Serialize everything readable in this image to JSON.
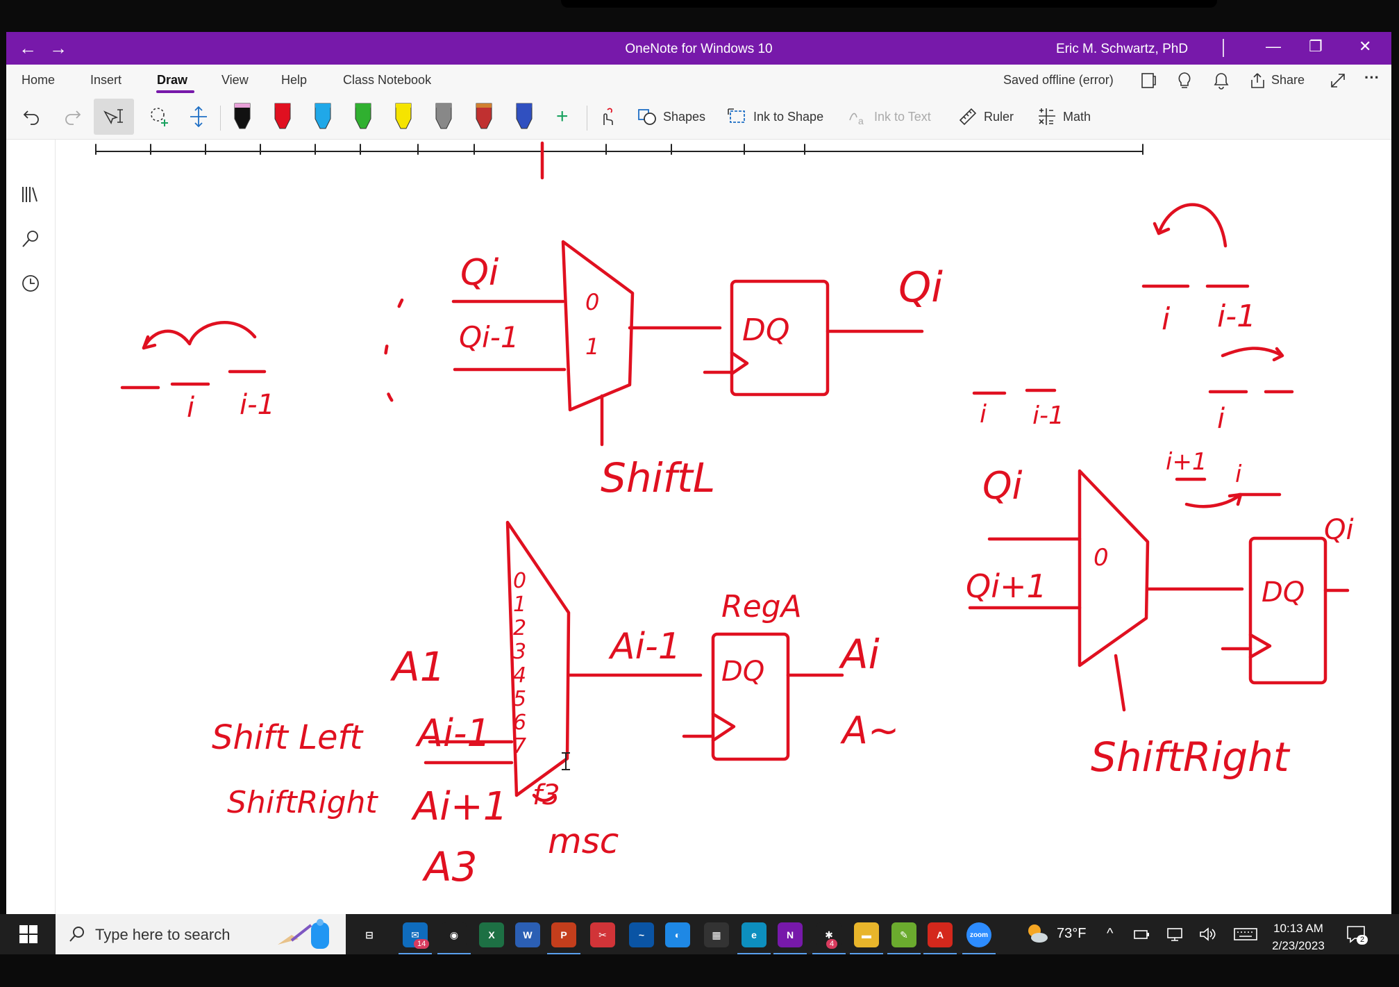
{
  "window": {
    "app_title": "OneNote for Windows 10",
    "user_name": "Eric M. Schwartz, PhD",
    "back_glyph": "←",
    "forward_glyph": "→",
    "minimize_glyph": "—",
    "restore_glyph": "❐",
    "close_glyph": "✕"
  },
  "menu": {
    "tabs": [
      {
        "label": "Home"
      },
      {
        "label": "Insert"
      },
      {
        "label": "Draw",
        "active": true
      },
      {
        "label": "View"
      },
      {
        "label": "Help"
      },
      {
        "label": "Class Notebook"
      }
    ],
    "status": "Saved offline (error)",
    "share_label": "Share",
    "more_glyph": "···"
  },
  "toolbar": {
    "shapes_label": "Shapes",
    "ink_to_shape_label": "Ink to Shape",
    "ink_to_text_label": "Ink to Text",
    "ruler_label": "Ruler",
    "math_label": "Math",
    "add_pen_glyph": "+",
    "pens": [
      {
        "name": "pen-black-pink",
        "color": "#111111",
        "cap": "#e8a0d8"
      },
      {
        "name": "pen-red",
        "color": "#e01020",
        "cap": "#e01020"
      },
      {
        "name": "pen-cyan",
        "color": "#20a8e8",
        "cap": "#20a8e8"
      },
      {
        "name": "pen-green",
        "color": "#30b030",
        "cap": "#30b030"
      },
      {
        "name": "highlighter-yellow",
        "color": "#f5e400",
        "cap": "#f5e400"
      },
      {
        "name": "pencil-gray",
        "color": "#888888",
        "cap": "#888888"
      },
      {
        "name": "pen-galaxy",
        "color": "#c03030",
        "cap": "#d08030"
      },
      {
        "name": "pen-galaxy-blue",
        "color": "#3050c0",
        "cap": "#3050c0"
      }
    ]
  },
  "colors": {
    "accent": "#7719aa",
    "ink": "#e01020"
  },
  "taskbar": {
    "search_placeholder": "Type here to search",
    "weather": "73°F",
    "time": "10:13 AM",
    "date": "2/23/2023",
    "mail_badge": "14",
    "slack_badge": "4",
    "notif_badge": "2",
    "apps": [
      {
        "name": "task-view-icon",
        "label": "⊟",
        "bg": "transparent"
      },
      {
        "name": "mail-app-icon",
        "label": "✉",
        "bg": "#0f6cbd"
      },
      {
        "name": "chrome-app-icon",
        "label": "◉",
        "bg": "#1f1f1f"
      },
      {
        "name": "excel-app-icon",
        "label": "X",
        "bg": "#1d7044"
      },
      {
        "name": "word-app-icon",
        "label": "W",
        "bg": "#2b5fb4"
      },
      {
        "name": "powerpoint-app-icon",
        "label": "P",
        "bg": "#c43e1c"
      },
      {
        "name": "snip-app-icon",
        "label": "✂",
        "bg": "#d13438"
      },
      {
        "name": "whiteboard-app-icon",
        "label": "~",
        "bg": "#0a54a4"
      },
      {
        "name": "app-blue-icon",
        "label": "◐",
        "bg": "#1e88e5"
      },
      {
        "name": "app-chip-icon",
        "label": "▦",
        "bg": "#333333"
      },
      {
        "name": "edge-app-icon",
        "label": "e",
        "bg": "#0d8fbf"
      },
      {
        "name": "onenote-app-icon",
        "label": "N",
        "bg": "#7719aa"
      },
      {
        "name": "slack-app-icon",
        "label": "✱",
        "bg": "#1f1f1f"
      },
      {
        "name": "explorer-app-icon",
        "label": "▬",
        "bg": "#e8b52b"
      },
      {
        "name": "app-green-icon",
        "label": "✎",
        "bg": "#6bab2e"
      },
      {
        "name": "acrobat-app-icon",
        "label": "A",
        "bg": "#d4281c"
      },
      {
        "name": "zoom-app-icon",
        "label": "zoom",
        "bg": "#2d8cff"
      }
    ]
  },
  "notes": {
    "shiftL_label": "ShiftL",
    "shiftRight_label": "ShiftRight",
    "shift_left": "Shift Left",
    "shift_right": "ShiftRight",
    "regA": "RegA",
    "msc": "msc",
    "a3": "A3",
    "f3": "f3",
    "qi": "Qi",
    "qi_minus1": "Qi-1",
    "qi_plus1": "Qi+1",
    "ai": "Ai",
    "ai_minus1": "Ai-1",
    "ai_plus1": "Ai+1",
    "a1": "A1",
    "a_tilde": "A~",
    "i": "i",
    "i_minus1": "i-1",
    "i_plus1": "i+1",
    "dq": "DQ",
    "mux_digits": [
      "0",
      "1",
      "2",
      "3",
      "4",
      "5",
      "6",
      "7"
    ]
  }
}
